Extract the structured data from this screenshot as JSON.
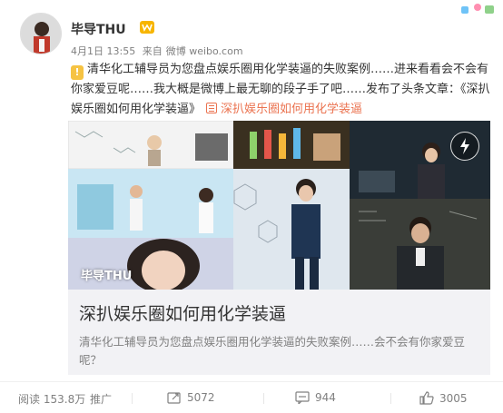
{
  "post": {
    "username": "毕导THU",
    "date": "4月1日 13:55",
    "source_prefix": "来自",
    "source": "微博 weibo.com",
    "text_main": "清华化工辅导员为您盘点娱乐圈用化学装逼的失败案例……进来看看会不会有你家爱豆呢……我大概是微博上最无聊的段子手了吧……发布了头条文章：《深扒娱乐圈如何用化学装逼》",
    "article_link": "深扒娱乐圈如何用化学装逼"
  },
  "card": {
    "title": "深扒娱乐圈如何用化学装逼",
    "description": "清华化工辅导员为您盘点娱乐圈用化学装逼的失败案例……会不会有你家爱豆呢？",
    "watermark": "毕导THU"
  },
  "actions": {
    "views_label": "阅读",
    "views": "153.8万",
    "promote": "推广",
    "reposts": "5072",
    "comments": "944",
    "likes": "3005"
  },
  "colors": {
    "link": "#eb7350",
    "gray_text": "#808080",
    "card_bg": "#f2f2f5"
  },
  "icons": [
    "lightbulb-icon",
    "vip-badge-icon",
    "article-icon",
    "video-play-icon",
    "repost-icon",
    "comment-icon",
    "like-icon"
  ]
}
